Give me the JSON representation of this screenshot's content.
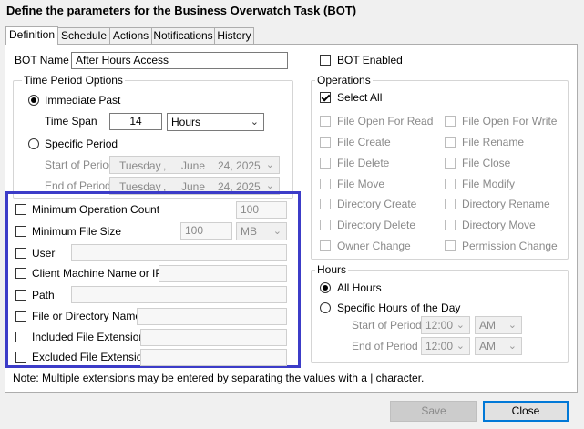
{
  "window": {
    "title": "Define the parameters for the Business Overwatch Task (BOT)"
  },
  "tabs": [
    {
      "label": "Definition"
    },
    {
      "label": "Schedule"
    },
    {
      "label": "Actions"
    },
    {
      "label": "Notifications"
    },
    {
      "label": "History"
    }
  ],
  "bot_name": {
    "label": "BOT Name",
    "value": "After Hours Access"
  },
  "bot_enabled": {
    "label": "BOT Enabled",
    "checked": false
  },
  "time_period": {
    "title": "Time Period Options",
    "immediate_past": "Immediate Past",
    "time_span_label": "Time Span",
    "time_span_value": "14",
    "time_span_unit": "Hours",
    "specific_period": "Specific Period",
    "start_label": "Start of Period",
    "end_label": "End of Period",
    "start_date": {
      "day": "Tuesday",
      "sep": ",",
      "month": "June",
      "date": "24, 2025"
    },
    "end_date": {
      "day": "Tuesday",
      "sep": ",",
      "month": "June",
      "date": "24, 2025"
    }
  },
  "filters": {
    "min_op_count": {
      "label": "Minimum Operation Count",
      "value": "100"
    },
    "min_file_size": {
      "label": "Minimum File Size",
      "value": "100",
      "unit": "MB"
    },
    "user": {
      "label": "User"
    },
    "client_machine": {
      "label": "Client Machine Name or IP"
    },
    "path": {
      "label": "Path"
    },
    "file_dir_name": {
      "label": "File or Directory Name"
    },
    "included_ext": {
      "label": "Included File Extensions"
    },
    "excluded_ext": {
      "label": "Excluded File Extensions"
    }
  },
  "operations": {
    "title": "Operations",
    "select_all": "Select All",
    "left": [
      "File Open For Read",
      "File Create",
      "File Delete",
      "File Move",
      "Directory Create",
      "Directory Delete",
      "Owner Change"
    ],
    "right": [
      "File Open For Write",
      "File Rename",
      "File Close",
      "File Modify",
      "Directory Rename",
      "Directory Move",
      "Permission Change"
    ]
  },
  "hours": {
    "title": "Hours",
    "all_hours": "All Hours",
    "specific_hours": "Specific Hours of the Day",
    "start_label": "Start of Period",
    "end_label": "End of Period",
    "start_time": "12:00",
    "start_ampm": "AM",
    "end_time": "12:00",
    "end_ampm": "AM"
  },
  "note": "Note: Multiple extensions may be entered by separating the values with a | character.",
  "buttons": {
    "save": "Save",
    "close": "Close"
  }
}
